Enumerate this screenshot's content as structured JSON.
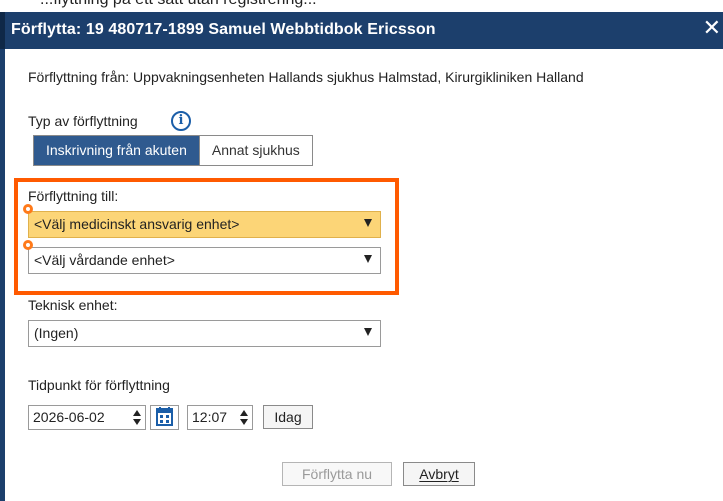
{
  "dialog": {
    "top_cut_text": "...flyttning på ett sätt utan registrering...",
    "title": "Förflytta: 19 480717-1899 Samuel Webbtidbok Ericsson",
    "close_icon": "close-icon"
  },
  "from": {
    "label": "Förflyttning från: Uppvakningsenheten Hallands sjukhus Halmstad, Kirurgikliniken Halland"
  },
  "type": {
    "label": "Typ av förflyttning",
    "info_icon": "i",
    "options": [
      "Inskrivning från akuten",
      "Annat sjukhus"
    ],
    "selected": "Inskrivning från akuten"
  },
  "destination": {
    "label": "Förflyttning till:",
    "medical_unit": "<Välj medicinskt ansvarig enhet>",
    "care_unit": "<Välj vårdande enhet>"
  },
  "technical": {
    "label": "Teknisk enhet:",
    "value": "(Ingen)"
  },
  "time": {
    "label": "Tidpunkt för förflyttning",
    "date": "2026-06-02",
    "clock": "12:07",
    "today_button": "Idag"
  },
  "actions": {
    "move_now": "Förflytta nu",
    "cancel": "Avbryt"
  },
  "colors": {
    "titlebar": "#1c3f6c",
    "highlight": "#ff5a00",
    "selected_segment": "#2f5a8f",
    "required_field": "#fcd577"
  }
}
